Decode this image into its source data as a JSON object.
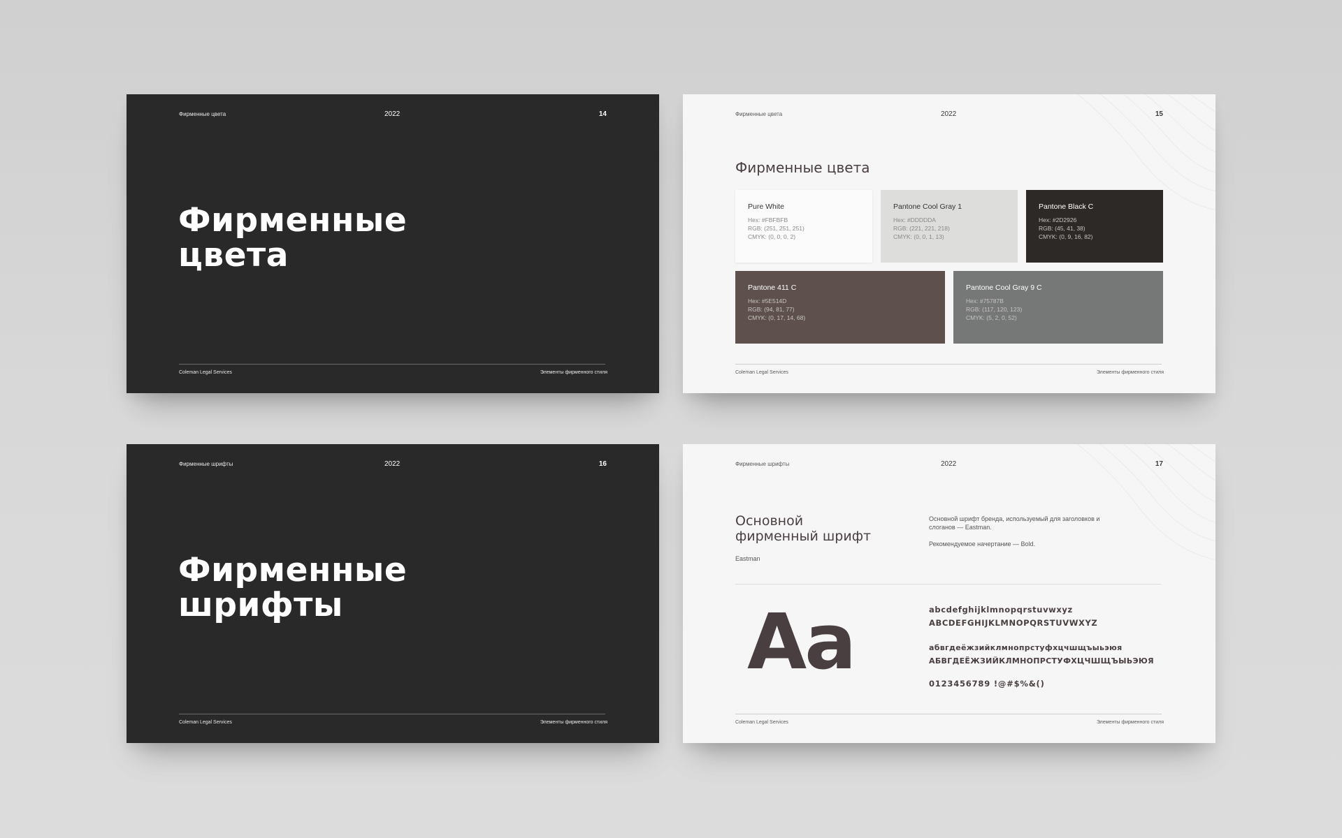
{
  "footer_left": "Coleman Legal Services",
  "footer_right": "Элементы фирменного стиля",
  "slides": [
    {
      "section": "Фирменные цвета",
      "year": "2022",
      "number": "14",
      "title": "Фирменные\nцвета"
    },
    {
      "section": "Фирменные цвета",
      "year": "2022",
      "number": "15",
      "heading": "Фирменные цвета",
      "swatches": [
        {
          "name": "Pure White",
          "hex": "Hex: #FBFBFB",
          "rgb": "RGB: (251, 251, 251)",
          "cmyk": "CMYK: (0, 0, 0, 2)",
          "color": "#FBFBFB"
        },
        {
          "name": "Pantone Cool Gray 1",
          "hex": "Hex: #DDDDDA",
          "rgb": "RGB: (221, 221, 218)",
          "cmyk": "CMYK: (0, 0, 1, 13)",
          "color": "#DDDDDA"
        },
        {
          "name": "Pantone Black C",
          "hex": "Hex: #2D2926",
          "rgb": "RGB: (45, 41, 38)",
          "cmyk": "CMYK: (0, 9, 16, 82)",
          "color": "#2D2926"
        },
        {
          "name": "Pantone 411 C",
          "hex": "Hex: #5E514D",
          "rgb": "RGB: (94, 81, 77)",
          "cmyk": "CMYK: (0, 17, 14, 68)",
          "color": "#5E514D"
        },
        {
          "name": "Pantone Cool Gray 9 C",
          "hex": "Hex: #75787B",
          "rgb": "RGB: (117, 120, 123)",
          "cmyk": "CMYK: (5, 2, 0, 52)",
          "color": "#75787B"
        }
      ]
    },
    {
      "section": "Фирменные шрифты",
      "year": "2022",
      "number": "16",
      "title": "Фирменные\nшрифты"
    },
    {
      "section": "Фирменные шрифты",
      "year": "2022",
      "number": "17",
      "heading": "Основной\nфирменный шрифт",
      "font_name": "Eastman",
      "description": "Основной шрифт бренда, используемый для заголовков и слоганов — Eastman.",
      "weight_note": "Рекомендуемое начертание — Bold.",
      "sample": "Aa",
      "latin_lower": "abcdefghijklmnopqrstuvwxyz",
      "latin_upper": "ABCDEFGHIJKLMNOPQRSTUVWXYZ",
      "cyr_lower": "абвгдеёжзийклмнопрстуфхцчшщъыьэюя",
      "cyr_upper": "АБВГДЕЁЖЗИЙКЛМНОПРСТУФХЦЧШЩЪЫЬЭЮЯ",
      "digits": "0123456789 !@#$%&()"
    }
  ],
  "colors": {
    "page_bg": "#d6d6d6",
    "dark_slide": "#292929",
    "light_slide": "#f6f6f6",
    "accent_text": "#4a3f40"
  }
}
